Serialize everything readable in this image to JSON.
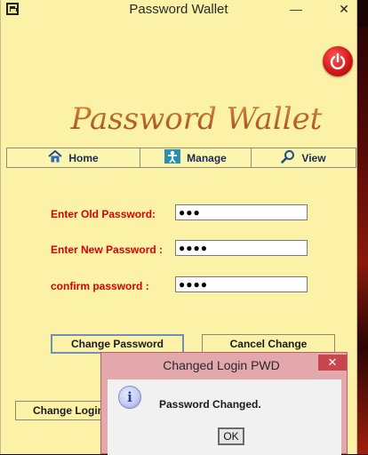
{
  "window": {
    "title": "Password Wallet",
    "minimize": "—",
    "maximize": "□",
    "close": "✕"
  },
  "logo": {
    "text": "Password Wallet"
  },
  "nav": {
    "items": [
      {
        "label": "Home",
        "icon": "home-icon"
      },
      {
        "label": "Manage",
        "icon": "manage-icon"
      },
      {
        "label": "View",
        "icon": "search-icon"
      }
    ]
  },
  "form": {
    "old_password_label": "Enter Old Password:",
    "old_password_value": "●●●",
    "new_password_label": "Enter New Password :",
    "new_password_value": "●●●●",
    "confirm_password_label": "confirm password :",
    "confirm_password_value": "●●●●"
  },
  "buttons": {
    "change_password": "Change Password",
    "cancel_change": "Cancel Change",
    "change_login": "Change Login"
  },
  "dialog": {
    "title": "Changed Login PWD",
    "close": "✕",
    "info_icon": "i",
    "message": "Password Changed.",
    "ok_label": "OK"
  },
  "colors": {
    "window_bg": "#fbf1a7",
    "label_red": "#d70000",
    "logo_brown": "#b0612a",
    "dialog_border": "#e2a8ac"
  }
}
